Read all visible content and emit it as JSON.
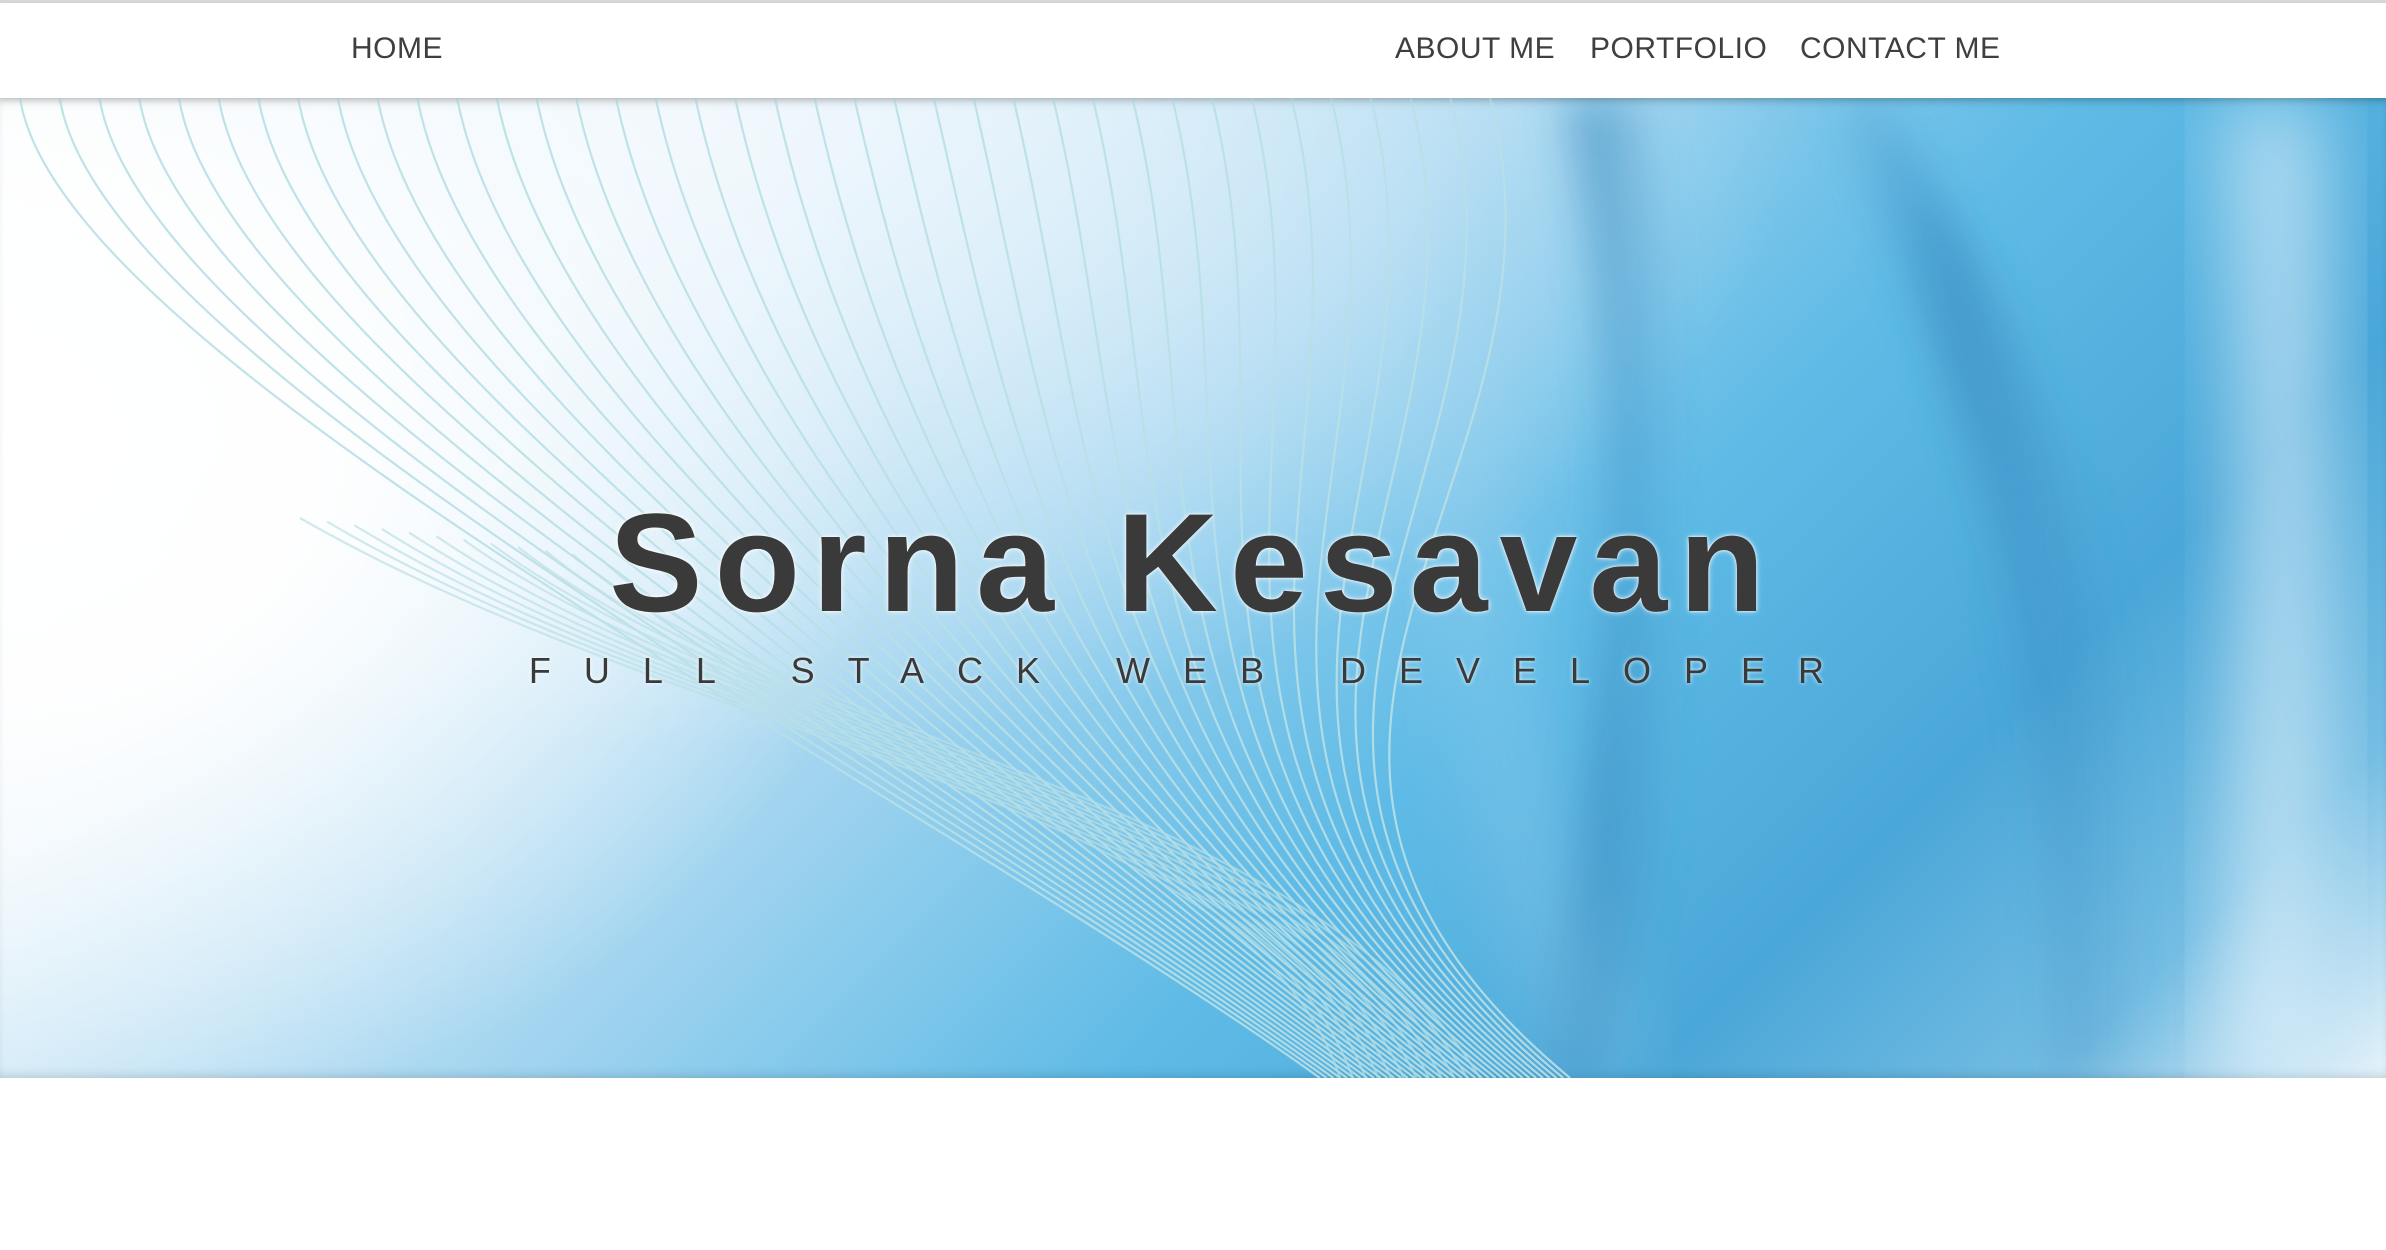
{
  "nav": {
    "home": "HOME",
    "about": "ABOUT ME",
    "portfolio": "PORTFOLIO",
    "contact": "CONTACT ME"
  },
  "hero": {
    "title": "Sorna Kesavan",
    "subtitle": "FULL STACK WEB DEVELOPER"
  },
  "colors": {
    "nav_text": "#3f3f3f",
    "hero_text": "#3a3a3a",
    "hero_blue": "#4aa7d8",
    "hero_light": "#e6f3fb",
    "line_color": "#b9e0e6"
  },
  "icons": []
}
